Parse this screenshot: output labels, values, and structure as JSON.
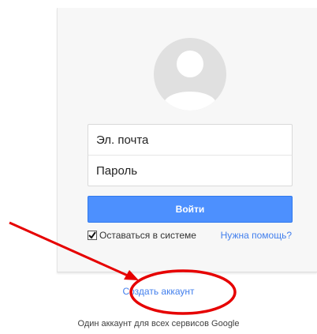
{
  "login": {
    "email_placeholder": "Эл. почта",
    "password_placeholder": "Пароль",
    "signin_label": "Войти",
    "stay_signed_in_label": "Оставаться в системе",
    "stay_signed_in_checked": true,
    "help_link": "Нужна помощь?"
  },
  "footer": {
    "create_account_link": "Создать аккаунт",
    "tagline": "Один аккаунт для всех сервисов Google"
  },
  "colors": {
    "button_blue": "#4d90fe",
    "link_blue": "#427fed",
    "annotation_red": "#e60000"
  },
  "icons": {
    "avatar": "default-avatar-icon",
    "check": "checkmark-icon"
  }
}
